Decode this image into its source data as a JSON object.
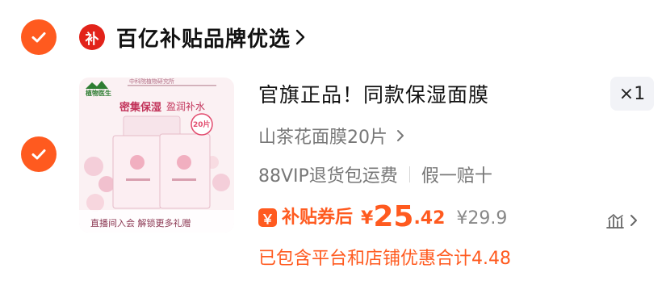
{
  "shop": {
    "logo_text": "补",
    "name": "百亿补贴品牌优选"
  },
  "product": {
    "title": "官旗正品！同款保湿面膜",
    "quantity": "×1",
    "spec": "山茶花面膜20片",
    "service_tags": [
      "88VIP退货包运费",
      "假一赔十"
    ],
    "coupon_icon": "￥",
    "coupon_label": "补贴券后",
    "price_currency": "¥",
    "price_int": "25",
    "price_dec": ".42",
    "price_original": "¥29.9",
    "discount_note": "已包含平台和店铺优惠合计4.48"
  },
  "thumbnail": {
    "brand": "植物医生",
    "slogan": "中科院植物研究所",
    "headline_main": "密集保湿",
    "headline_sub": "盈润补水",
    "badge": "20片",
    "footer": "直播间入会 解锁更多礼赠"
  },
  "colors": {
    "accent": "#FF5A1F",
    "thumb_bg": "#FBF1F3"
  },
  "icons": [
    "check-icon",
    "chevron-right-icon",
    "price-trend-icon"
  ]
}
